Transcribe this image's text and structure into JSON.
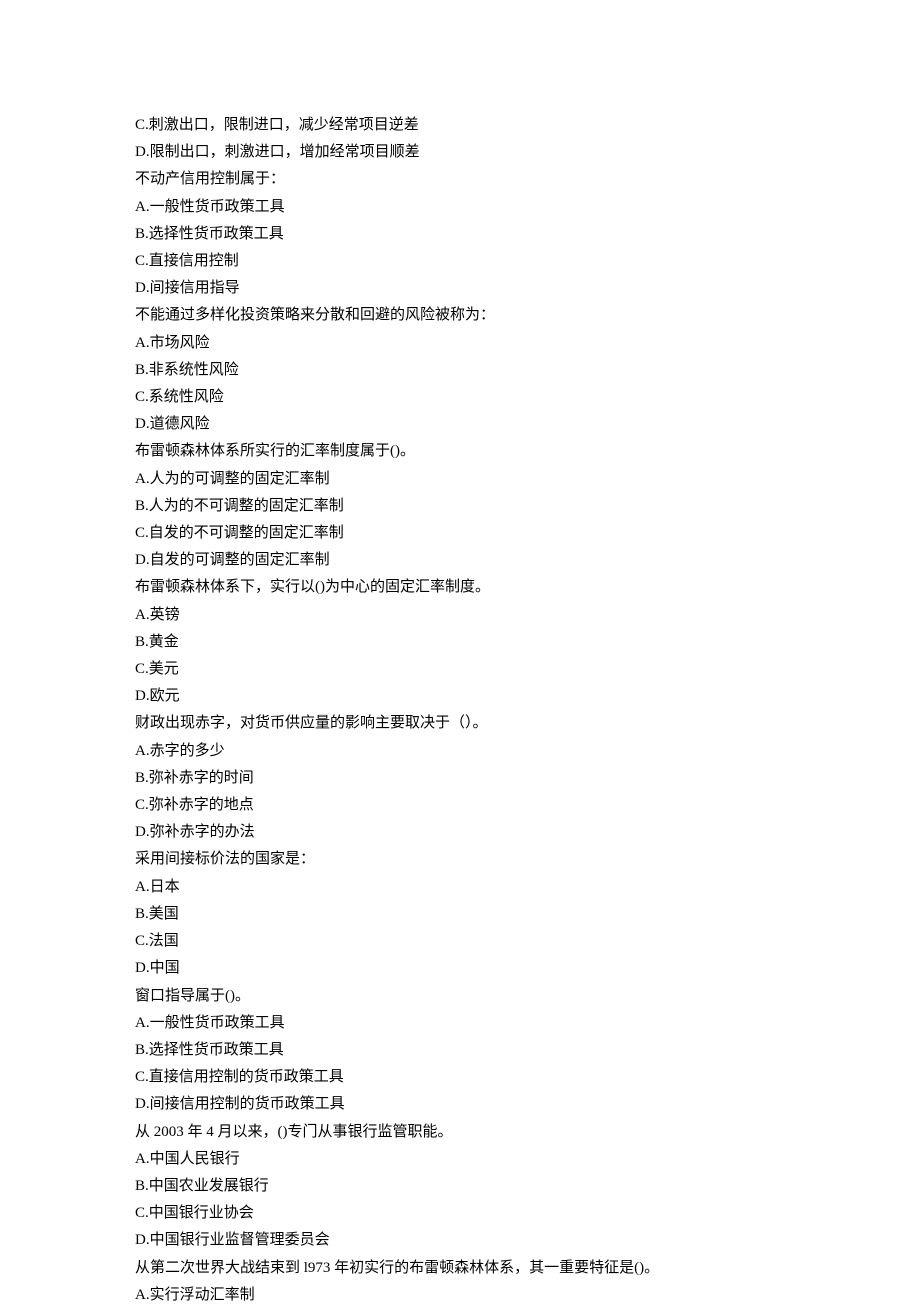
{
  "lines": [
    "C.刺激出口，限制进口，减少经常项目逆差",
    "D.限制出口，刺激进口，增加经常项目顺差",
    "不动产信用控制属于：",
    "A.一般性货币政策工具",
    "B.选择性货币政策工具",
    "C.直接信用控制",
    "D.间接信用指导",
    "不能通过多样化投资策略来分散和回避的风险被称为：",
    "A.市场风险",
    "B.非系统性风险",
    "C.系统性风险",
    "D.道德风险",
    "布雷顿森林体系所实行的汇率制度属于()。",
    "A.人为的可调整的固定汇率制",
    "B.人为的不可调整的固定汇率制",
    "C.自发的不可调整的固定汇率制",
    "D.自发的可调整的固定汇率制",
    "布雷顿森林体系下，实行以()为中心的固定汇率制度。",
    "A.英镑",
    "B.黄金",
    "C.美元",
    "D.欧元",
    "财政出现赤字，对货币供应量的影响主要取决于（）。",
    "A.赤字的多少",
    "B.弥补赤字的时间",
    "C.弥补赤字的地点",
    "D.弥补赤字的办法",
    "采用间接标价法的国家是：",
    "A.日本",
    "B.美国",
    "C.法国",
    "D.中国",
    "窗口指导属于()。",
    "A.一般性货币政策工具",
    "B.选择性货币政策工具",
    "C.直接信用控制的货币政策工具",
    "D.间接信用控制的货币政策工具",
    "从 2003 年 4 月以来，()专门从事银行监管职能。",
    "A.中国人民银行",
    "B.中国农业发展银行",
    "C.中国银行业协会",
    "D.中国银行业监督管理委员会",
    "从第二次世界大战结束到 l973 年初实行的布雷顿森林体系，其一重要特征是()。",
    "A.实行浮动汇率制"
  ]
}
